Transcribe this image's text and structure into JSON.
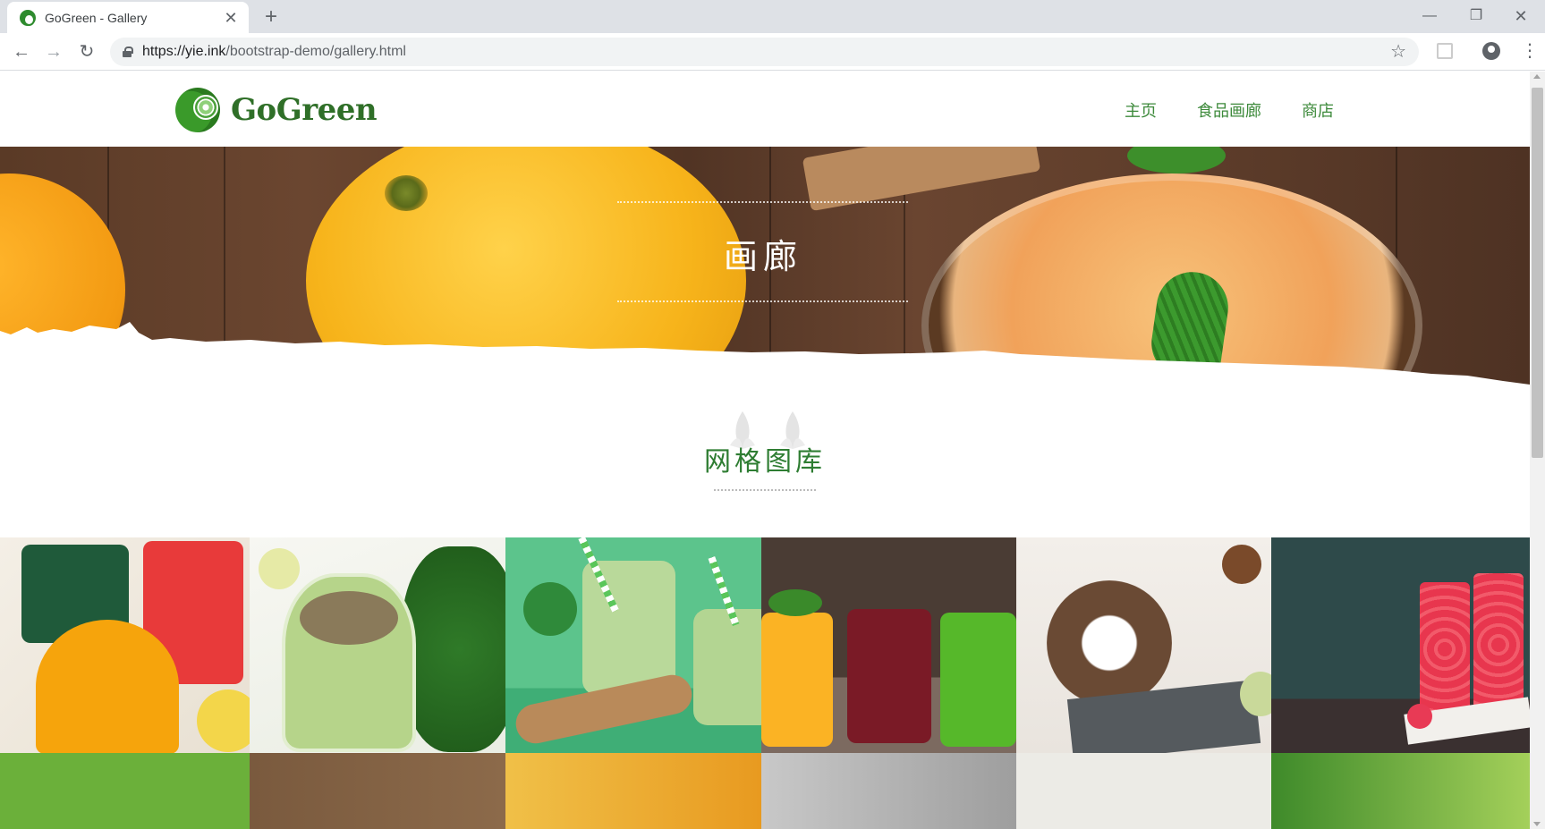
{
  "browser": {
    "tab_title": "GoGreen - Gallery",
    "url_host": "https://yie.ink",
    "url_path": "/bootstrap-demo/gallery.html",
    "tab_close_glyph": "✕",
    "new_tab_glyph": "+",
    "back_glyph": "←",
    "forward_glyph": "→",
    "reload_glyph": "↻",
    "star_glyph": "☆",
    "menu_glyph": "⋮",
    "min_glyph": "—",
    "max_glyph": "❐",
    "close_glyph": "✕"
  },
  "site": {
    "logo_text": "GoGreen",
    "nav": [
      {
        "label": "主页"
      },
      {
        "label": "食品画廊"
      },
      {
        "label": "商店"
      }
    ],
    "brand_color": "#2f6f28",
    "nav_color": "#3d8a3b"
  },
  "hero": {
    "title": "画廊"
  },
  "section": {
    "title": "网格图库",
    "title_color": "#2e7d32"
  },
  "gallery": {
    "tiles": [
      {
        "name": "juice-glasses-orange-red-green"
      },
      {
        "name": "green-smoothie-jar-spinach"
      },
      {
        "name": "green-smoothie-jars-straws"
      },
      {
        "name": "juice-jars-yellow-red-green"
      },
      {
        "name": "coconut-chocolate-smoothie"
      },
      {
        "name": "raspberry-glasses"
      },
      {
        "name": "row2-tile-1"
      },
      {
        "name": "row2-tile-2"
      },
      {
        "name": "row2-tile-3"
      },
      {
        "name": "row2-tile-4"
      },
      {
        "name": "row2-tile-5"
      },
      {
        "name": "row2-tile-6"
      }
    ]
  }
}
